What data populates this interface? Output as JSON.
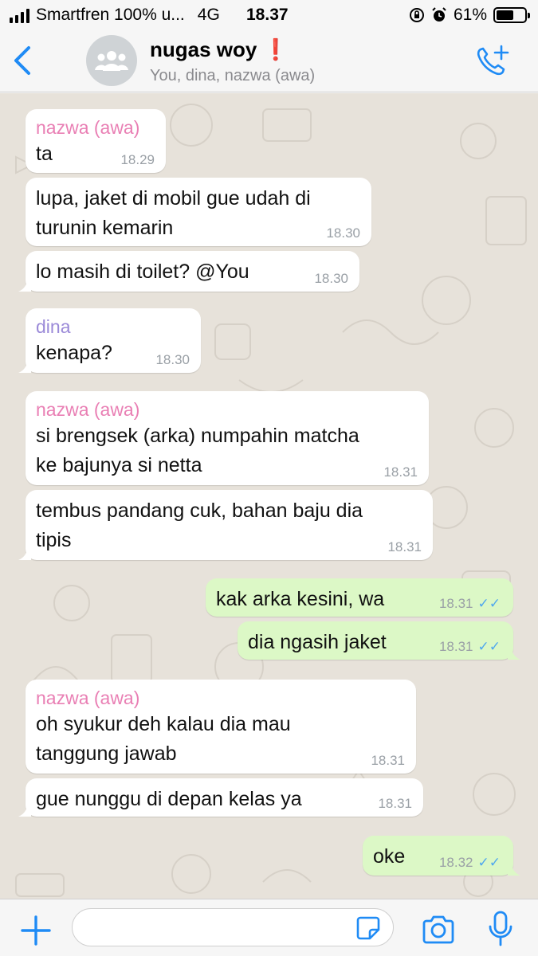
{
  "status": {
    "carrier": "Smartfren 100% u...",
    "network": "4G",
    "time": "18.37",
    "battery": "61%",
    "battery_level": 0.61
  },
  "header": {
    "title": "nugas woy",
    "title_emoji": "❗",
    "subtitle": "You, dina, nazwa (awa)"
  },
  "colors": {
    "accent": "#1f8bf5",
    "sender_nazwa": "#e97fb4",
    "sender_dina": "#9b8ad8",
    "outgoing": "#dcf8c6",
    "ticks": "#4fa7ee"
  },
  "messages": [
    {
      "sender": "nazwa (awa)",
      "lines": [
        "ta"
      ],
      "time": "18.29"
    },
    {
      "lines": [
        "lupa, jaket di mobil gue udah di",
        "turunin kemarin"
      ],
      "time": "18.30"
    },
    {
      "lines": [
        "lo masih di toilet? @You"
      ],
      "time": "18.30"
    },
    {
      "sender": "dina",
      "lines": [
        "kenapa?"
      ],
      "time": "18.30"
    },
    {
      "sender": "nazwa (awa)",
      "lines": [
        "si brengsek (arka) numpahin matcha",
        "ke bajunya si netta"
      ],
      "time": "18.31"
    },
    {
      "lines": [
        "tembus pandang cuk, bahan baju dia",
        "tipis"
      ],
      "time": "18.31"
    },
    {
      "lines": [
        "kak arka kesini, wa"
      ],
      "time": "18.31"
    },
    {
      "lines": [
        "dia ngasih jaket"
      ],
      "time": "18.31"
    },
    {
      "sender": "nazwa (awa)",
      "lines": [
        "oh syukur deh kalau dia mau",
        "tanggung jawab"
      ],
      "time": "18.31"
    },
    {
      "lines": [
        "gue nunggu di depan kelas ya"
      ],
      "time": "18.31"
    },
    {
      "lines": [
        "oke"
      ],
      "time": "18.32"
    }
  ],
  "input": {
    "placeholder": ""
  },
  "icons": {
    "back": "chevron-left-icon",
    "group_avatar": "group-icon",
    "add_call": "add-call-icon",
    "plus": "plus-icon",
    "sticker": "sticker-icon",
    "camera": "camera-icon",
    "mic": "microphone-icon",
    "read": "double-check-icon"
  }
}
